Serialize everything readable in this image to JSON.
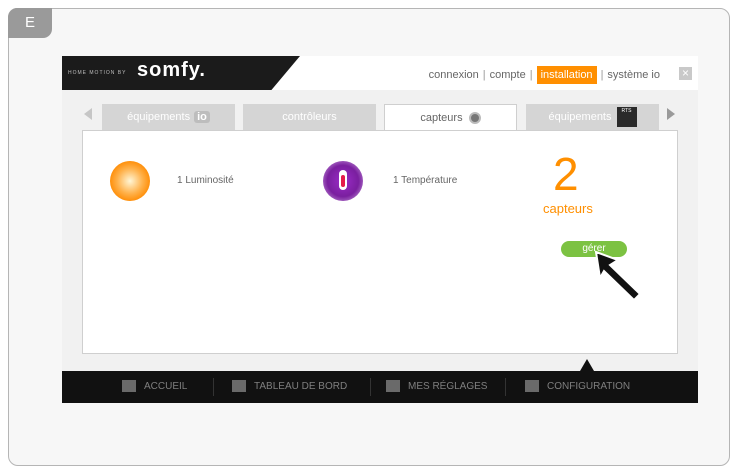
{
  "tag": {
    "letter": "E"
  },
  "header": {
    "brand_small": "HOME MOTION BY",
    "brand": "somfy.",
    "nav": [
      "connexion",
      "compte",
      "installation",
      "système io"
    ],
    "active_nav": "installation"
  },
  "tabs": [
    {
      "label": "équipements",
      "badge": "io"
    },
    {
      "label": "contrôleurs"
    },
    {
      "label": "capteurs"
    },
    {
      "label": "équipements",
      "badge": "RTS"
    }
  ],
  "sensors": [
    {
      "label": "1 Luminosité",
      "icon": "sun-sensor-icon"
    },
    {
      "label": "1 Température",
      "icon": "thermometer-icon"
    }
  ],
  "summary": {
    "count": "2",
    "label": "capteurs",
    "button": "gérer"
  },
  "bottom_nav": [
    "ACCUEIL",
    "TABLEAU DE BORD",
    "MES RÉGLAGES",
    "CONFIGURATION"
  ],
  "colors": {
    "accent": "#ff8f00",
    "green": "#7cc242",
    "dark": "#111111"
  }
}
